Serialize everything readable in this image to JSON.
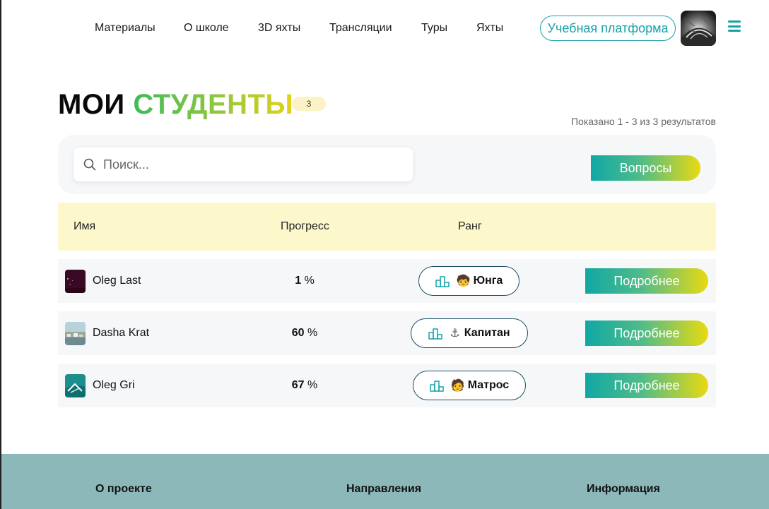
{
  "nav": {
    "links": [
      "Материалы",
      "О школе",
      "3D яхты",
      "Трансляции",
      "Туры",
      "Яхты"
    ],
    "platform_button": "Учебная платформа",
    "avatar_icon": "user-avatar",
    "menu_icon": "hamburger-icon"
  },
  "page": {
    "title_part1": "МОИ",
    "title_part2": "СТУДЕНТЫ",
    "count": "3",
    "results_info": "Показано 1 - 3 из 3 результатов"
  },
  "search": {
    "placeholder": "Поиск...",
    "value": "",
    "questions_button": "Вопросы"
  },
  "table": {
    "headers": {
      "name": "Имя",
      "progress": "Прогресс",
      "rank": "Ранг"
    },
    "rows": [
      {
        "name": "Oleg Last",
        "progress_value": "1",
        "progress_unit": "%",
        "rank_emoji": "🧒",
        "rank": "Юнга",
        "details": "Подробнее"
      },
      {
        "name": "Dasha Krat",
        "progress_value": "60",
        "progress_unit": "%",
        "rank_emoji": "⚓",
        "rank": "Капитан",
        "details": "Подробнее"
      },
      {
        "name": "Oleg Gri",
        "progress_value": "67",
        "progress_unit": "%",
        "rank_emoji": "🧑",
        "rank": "Матрос",
        "details": "Подробнее"
      }
    ]
  },
  "footer": {
    "col1": "О проекте",
    "col2": "Направления",
    "col3": "Информация"
  },
  "colors": {
    "accent_teal": "#17a2a8",
    "gradient_start": "#10a8a4",
    "gradient_end": "#e9da10",
    "header_row_bg": "#fdf7cc",
    "footer_bg": "#8db8b9"
  }
}
